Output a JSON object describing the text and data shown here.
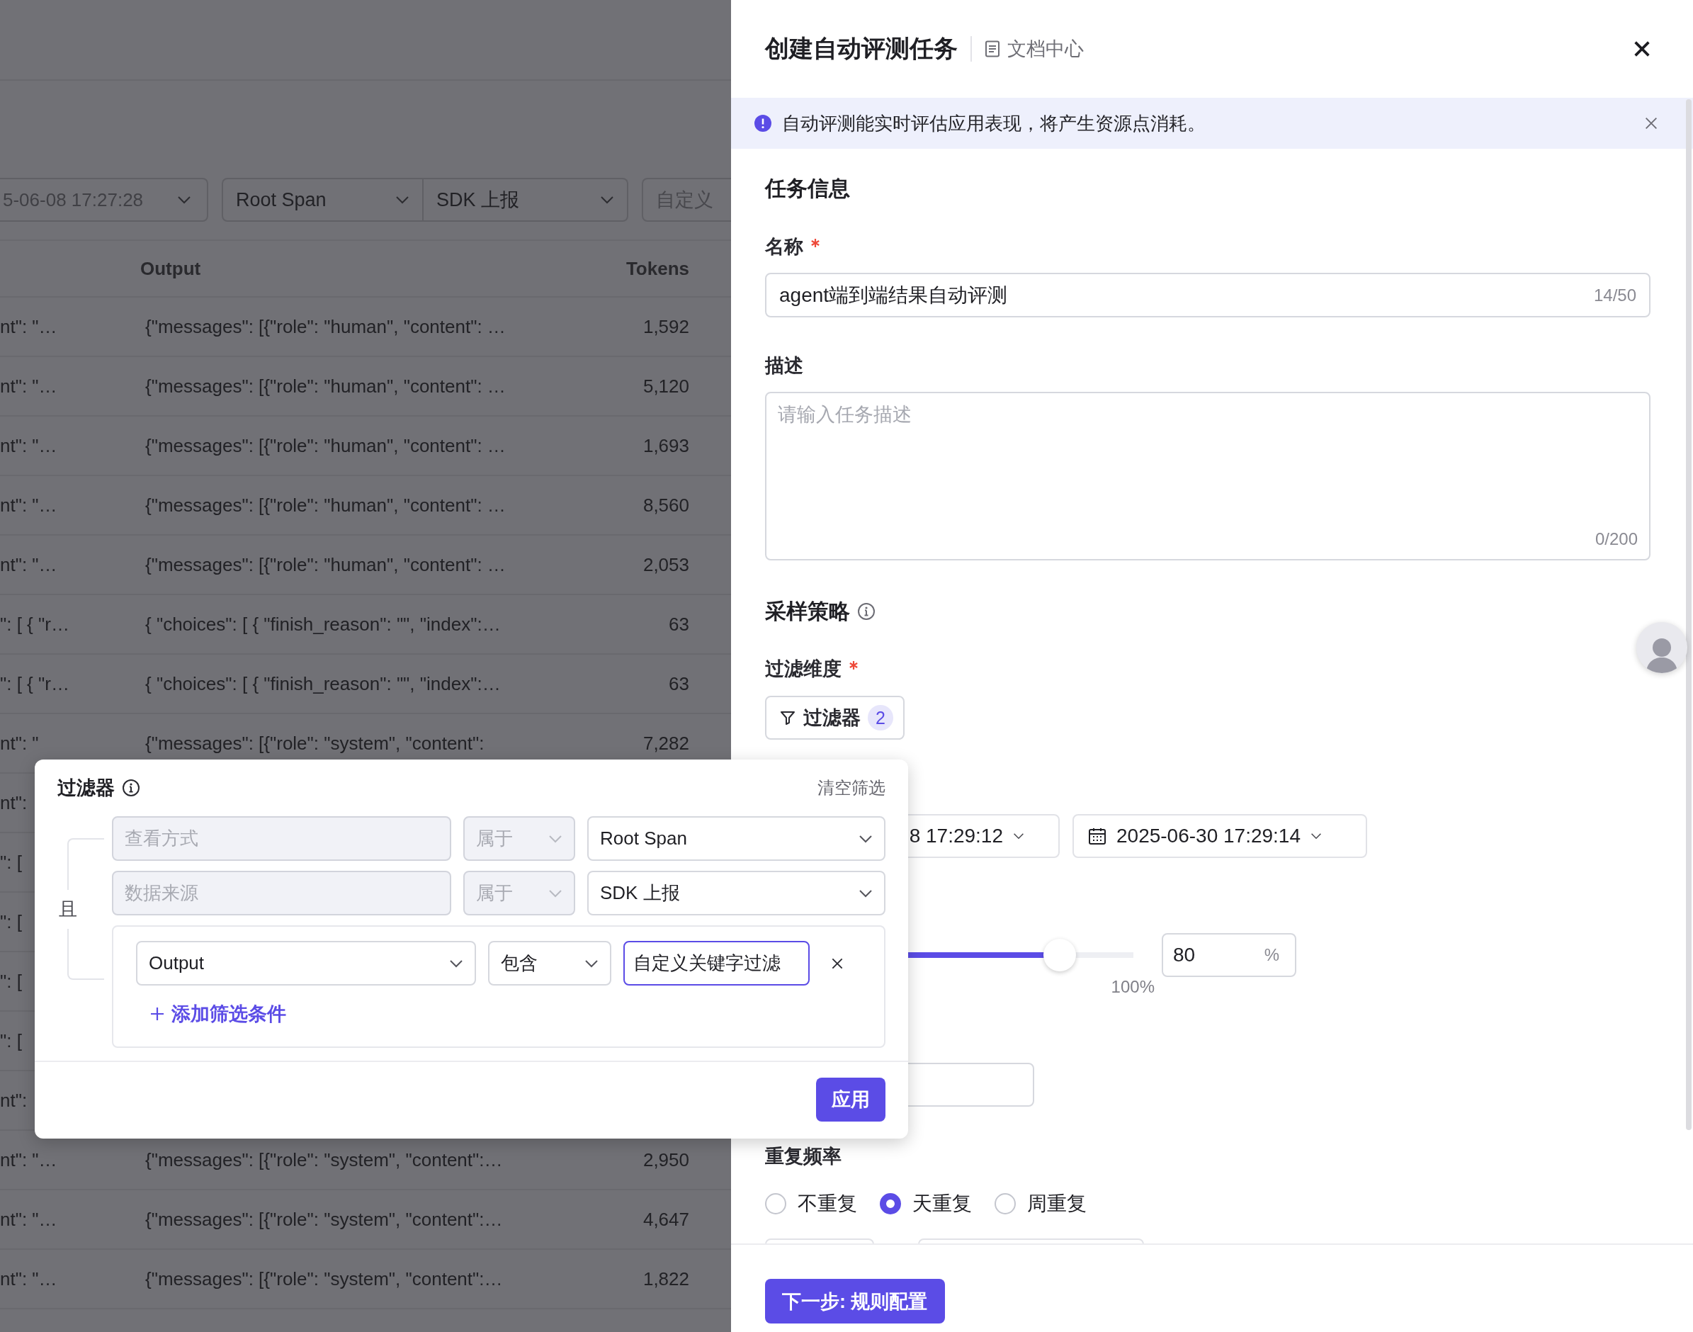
{
  "background_page": {
    "toolbar": {
      "time_end": "5-06-08 17:27:28",
      "selects": [
        {
          "value": "Root Span"
        },
        {
          "value": "SDK 上报"
        }
      ],
      "view_button": "自定义"
    },
    "table": {
      "columns": [
        "Output",
        "Tokens"
      ],
      "rows": [
        {
          "column_1": "nt\": \"…",
          "output": "{\"messages\": [{\"role\": \"human\", \"content\": …",
          "tokens": "1,592"
        },
        {
          "column_1": "nt\": \"…",
          "output": "{\"messages\": [{\"role\": \"human\", \"content\": …",
          "tokens": "5,120"
        },
        {
          "column_1": "nt\": \"…",
          "output": "{\"messages\": [{\"role\": \"human\", \"content\": …",
          "tokens": "1,693"
        },
        {
          "column_1": "nt\": \"…",
          "output": "{\"messages\": [{\"role\": \"human\", \"content\": …",
          "tokens": "8,560"
        },
        {
          "column_1": "nt\": \"…",
          "output": "{\"messages\": [{\"role\": \"human\", \"content\": …",
          "tokens": "2,053"
        },
        {
          "column_1": "\": [ { \"r…",
          "output": "{ \"choices\": [ { \"finish_reason\": \"\", \"index\":…",
          "tokens": "63"
        },
        {
          "column_1": "\": [ { \"r…",
          "output": "{ \"choices\": [ { \"finish_reason\": \"\", \"index\":…",
          "tokens": "63"
        },
        {
          "column_1": "nt\": \"",
          "output": "{\"messages\": [{\"role\": \"system\", \"content\":",
          "tokens": "7,282"
        },
        {
          "column_1": "nt\":"
        },
        {
          "column_1": "\": ["
        },
        {
          "column_1": "\": ["
        },
        {
          "column_1": "\": ["
        },
        {
          "column_1": "\": ["
        },
        {
          "column_1": "nt\":"
        },
        {
          "column_1": "nt\": \"…",
          "output": "{\"messages\": [{\"role\": \"system\", \"content\":…",
          "tokens": "2,950"
        },
        {
          "column_1": "nt\": \"…",
          "output": "{\"messages\": [{\"role\": \"system\", \"content\":…",
          "tokens": "4,647"
        },
        {
          "column_1": "nt\": \"…",
          "output": "{\"messages\": [{\"role\": \"system\", \"content\":…",
          "tokens": "1,822"
        }
      ]
    }
  },
  "drawer": {
    "title": "创建自动评测任务",
    "doc_link": "文档中心",
    "alert": {
      "text": "自动评测能实时评估应用表现，将产生资源点消耗。"
    },
    "section_title": "任务信息",
    "fields": [
      {
        "kind": "input",
        "label": "名称",
        "required": true,
        "value": "agent端到端结果自动评测",
        "counter": "14/50"
      },
      {
        "kind": "textarea",
        "label": "描述",
        "required": false,
        "placeholder": "请输入任务描述",
        "counter": "0/200"
      }
    ],
    "sampling": {
      "title": "采样策略",
      "filter_label": "过滤维度",
      "filter_required": true,
      "filter_button": {
        "label": "过滤器",
        "count": "2"
      },
      "time_range": {
        "start": "8 17:29:12",
        "end": "2025-06-30 17:29:14"
      },
      "rate": {
        "level": 0.8,
        "max_label": "100%",
        "value": "80",
        "unit": "%"
      },
      "frequency": {
        "label": "重复频率",
        "options": [
          {
            "label": "不重复",
            "selected": false
          },
          {
            "label": "天重复",
            "selected": true
          },
          {
            "label": "周重复",
            "selected": false
          }
        ]
      }
    },
    "next_button": "下一步: 规则配置"
  },
  "filter_popover": {
    "title": "过滤器",
    "clear": "清空筛选",
    "conjunction": "且",
    "fixed_conditions": [
      {
        "field": "查看方式",
        "operator": "属于",
        "value": "Root Span",
        "disabled": true
      },
      {
        "field": "数据来源",
        "operator": "属于",
        "value": "SDK 上报",
        "disabled": true
      }
    ],
    "custom_conditions": [
      {
        "field": "Output",
        "operator": "包含",
        "value": "自定义关键字过滤",
        "focused": true
      }
    ],
    "add_condition": "添加筛选条件",
    "apply": "应用"
  }
}
